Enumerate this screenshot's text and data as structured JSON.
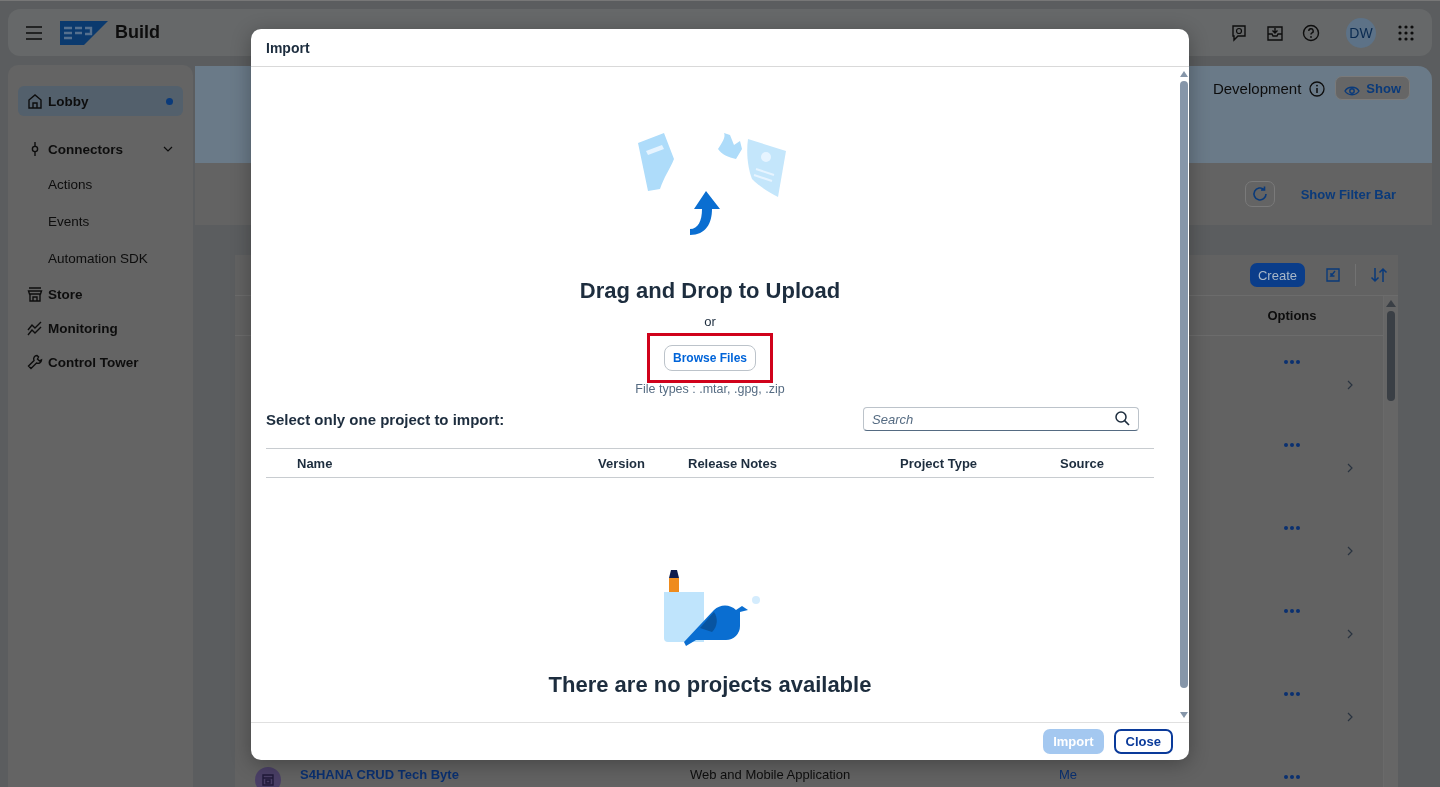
{
  "header": {
    "title": "Build",
    "avatar": "DW"
  },
  "sidebar": {
    "items": [
      {
        "label": "Lobby",
        "selected": true,
        "dot": true
      },
      {
        "label": "Connectors",
        "selected": false,
        "dot": false,
        "expanded": true,
        "children": [
          {
            "label": "Actions",
            "selected": false
          },
          {
            "label": "Events",
            "selected": false
          },
          {
            "label": "Automation SDK",
            "selected": false
          }
        ]
      },
      {
        "label": "Store",
        "selected": false,
        "dot": false
      },
      {
        "label": "Monitoring",
        "selected": false,
        "dot": false
      },
      {
        "label": "Control Tower",
        "selected": false,
        "dot": false
      }
    ]
  },
  "environment": {
    "label": "Development",
    "show_button": "Show"
  },
  "filter_bar": {
    "toggle": "Show Filter Bar"
  },
  "projects_table": {
    "create_button": "Create",
    "options_column": "Options",
    "rows": [
      {
        "chevron": true
      },
      {
        "chevron": true
      },
      {
        "chevron": true
      },
      {
        "chevron": true
      },
      {
        "chevron": true
      },
      {
        "name": "S4HANA CRUD Tech Byte",
        "type": "Web and Mobile Application",
        "owner": "Me",
        "chevron": false
      }
    ]
  },
  "dialog": {
    "title": "Import",
    "drop_title": "Drag and Drop to Upload",
    "or": "or",
    "browse_button": "Browse Files",
    "browse_highlighted": true,
    "file_types": "File types : .mtar, .gpg, .zip",
    "select_label": "Select only one project to import:",
    "search": {
      "placeholder": "Search"
    },
    "columns": [
      "Name",
      "Version",
      "Release Notes",
      "Project Type",
      "Source"
    ],
    "empty_text": "There are no projects available",
    "buttons": [
      {
        "label": "Import",
        "kind": "primary",
        "disabled": true
      },
      {
        "label": "Close",
        "kind": "secondary",
        "disabled": false
      }
    ]
  }
}
